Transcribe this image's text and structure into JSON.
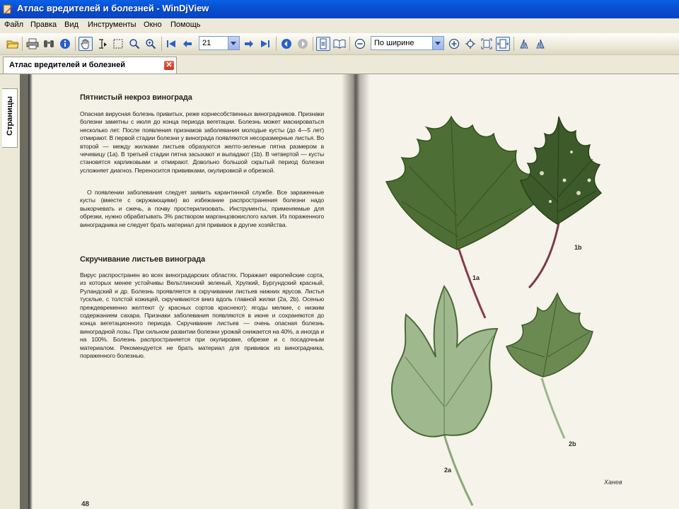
{
  "window": {
    "title": "Атлас вредителей и болезней - WinDjView"
  },
  "menu": [
    "Файл",
    "Правка",
    "Вид",
    "Инструменты",
    "Окно",
    "Помощь"
  ],
  "toolbar": {
    "page_number": "21",
    "zoom": "По ширине"
  },
  "tab": {
    "label": "Атлас вредителей и болезней"
  },
  "sidebar": {
    "tab_label": "Страницы"
  },
  "document": {
    "heading1": "Пятнистый некроз винограда",
    "para1": "Опасная вирусная болезнь привитых, реже корнесобственных виноградников. Признаки болезни заметны с июля до конца периода вегетации. Болезнь может маскироваться несколько лет. После появления признаков заболевания молодые кусты (до 4—5 лет) отмирают. В первой стадии болезни у винограда появляются несоразмерные листья. Во второй — между жилками листьев образуются желто-зеленые пятна размером в чечевицу (1a). В третьей стадии пятна засыхают и выпадают (1b). В четвертой — кусты становятся карликовыми и отмирают. Довольно большой скрытый период болезни усложняет диагноз. Переносится прививками, окулировкой и обрезкой.",
    "para2": "О появлении заболевания следует заявить карантинной службе. Все зараженные кусты (вместе с окружающими) во избежание распространения болезни надо выкорчевать и сжечь, а почву простерилизовать. Инструменты, применяемые для обрезки, нужно обрабатывать 3% раствором марганцовокислого калия. Из пораженного виноградника не следует брать материал для прививок в другие хозяйства.",
    "heading2": "Скручивание листьев винограда",
    "para3": "Вирус распространен во всех виноградарских областях. Поражает европейские сорта, из которых менее устойчивы Вельтлинский зеленый, Хрупкий, Бургундский красный, Руландский и др. Болезнь проявляется в скручивании листьев нижних ярусов. Листья тусклые, с толстой кожицей, скручиваются вниз вдоль главной жилки (2a, 2b). Осенью преждевременно желтеют (у красных сортов краснеют); ягоды мелкие, с низким содержанием сахара. Признаки заболевания появляются в июне и сохраняются до конца вегетационного периода. Скручивание листьев — очень опасная болезнь виноградной лозы. При сильном развитии болезни урожай снижается на 40%, а иногда и на 100%. Болезнь распространяется при окулировке, обрезке и с посадочным материалом. Рекомендуется не брать материал для прививок из виноградника, пораженного болезнью.",
    "page_number": "48",
    "labels": {
      "l1a": "1a",
      "l1b": "1b",
      "l2a": "2a",
      "l2b": "2b"
    },
    "signature": "Ханев"
  },
  "colors": {
    "titlebar": "#0850d0",
    "leaf_dark": "#3c5a2a",
    "leaf_pale": "#9fb88e",
    "stem": "#8a3a4a"
  }
}
